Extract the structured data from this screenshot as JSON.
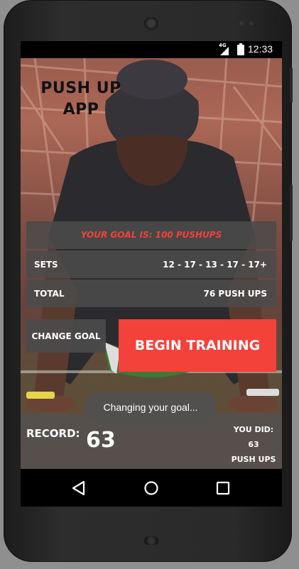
{
  "status_bar": {
    "network": "4G",
    "time": "12:33"
  },
  "app": {
    "logo_line1": "PUSH UP",
    "logo_line2": "APP",
    "goal_text": "YOUR GOAL IS: 100 PUSHUPS",
    "sets_label": "SETS",
    "sets_value": "12 - 17 - 13 - 17 - 17+",
    "total_label": "TOTAL",
    "total_value": "76 PUSH UPS",
    "change_goal_label": "CHANGE GOAL",
    "begin_training_label": "BEGIN TRAINING",
    "toast": "Changing your goal...",
    "record_label": "RECORD:",
    "record_value": "63",
    "you_did_label": "YOU DID:",
    "you_did_value": "63",
    "you_did_unit": "PUSH UPS"
  },
  "colors": {
    "accent": "#f2423a",
    "panel": "#4b4b4b"
  },
  "icons": {
    "back": "back-triangle-icon",
    "home": "home-circle-icon",
    "recents": "recents-square-icon"
  }
}
